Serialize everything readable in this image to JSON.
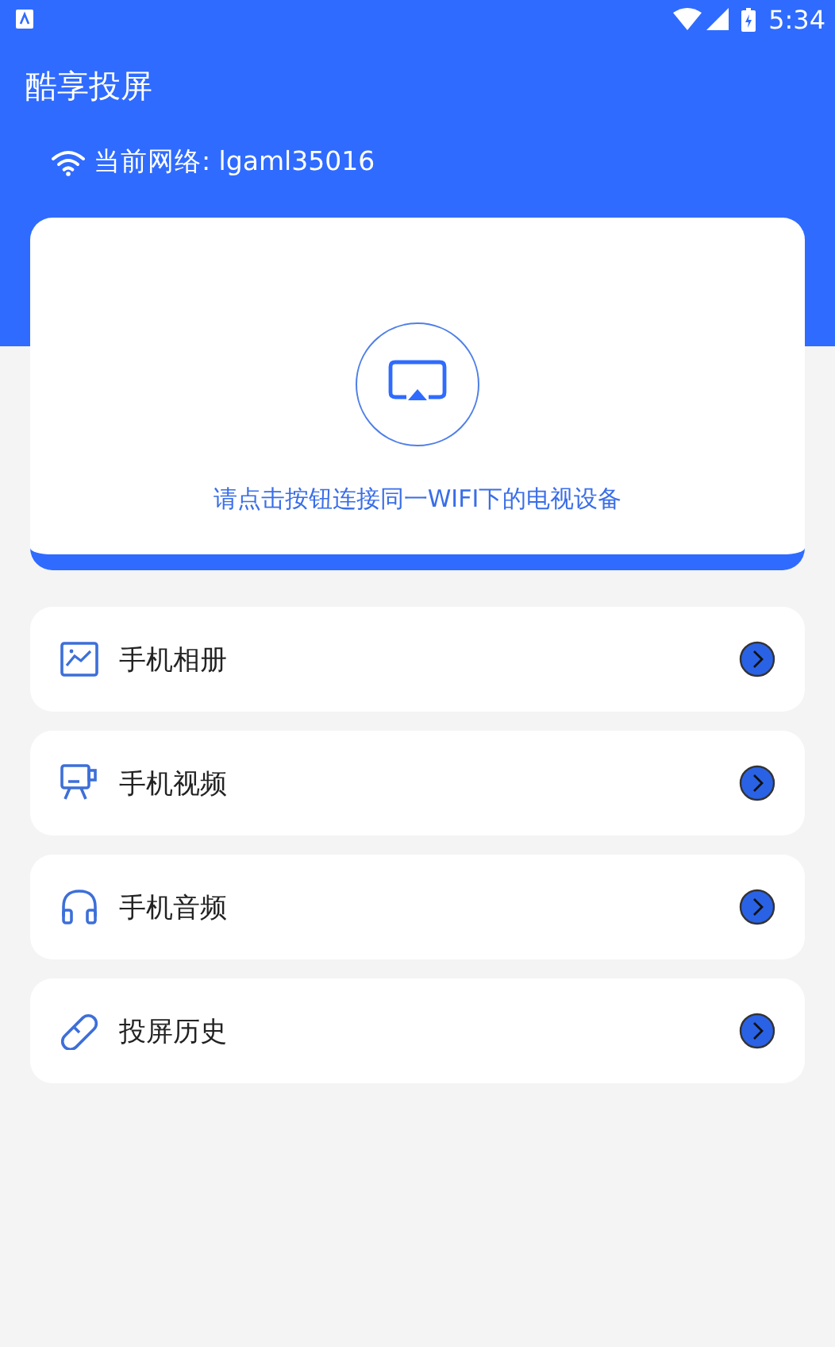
{
  "status_bar": {
    "time": "5:34"
  },
  "app_bar": {
    "title": "酷享投屏"
  },
  "network": {
    "label": "当前网络: lgaml35016"
  },
  "cast_card": {
    "hint": "请点击按钮连接同一WIFI下的电视设备"
  },
  "menu": [
    {
      "kind": "photo",
      "label": "手机相册"
    },
    {
      "kind": "video",
      "label": "手机视频"
    },
    {
      "kind": "audio",
      "label": "手机音频"
    },
    {
      "kind": "history",
      "label": "投屏历史"
    }
  ]
}
